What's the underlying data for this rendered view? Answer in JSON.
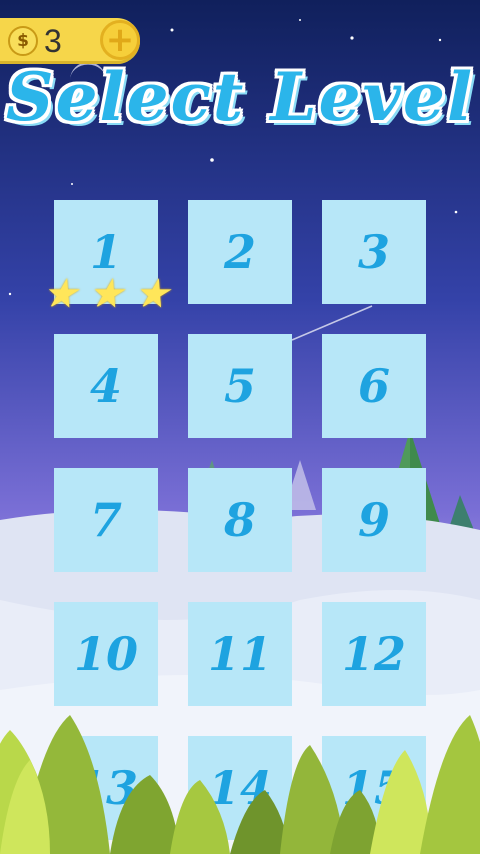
{
  "coins": {
    "currency_symbol": "$",
    "count": "3",
    "add_label": "+"
  },
  "title": "Select Level",
  "levels": [
    {
      "label": "1",
      "stars": 3
    },
    {
      "label": "2",
      "stars": 0
    },
    {
      "label": "3",
      "stars": 0
    },
    {
      "label": "4",
      "stars": 0
    },
    {
      "label": "5",
      "stars": 0
    },
    {
      "label": "6",
      "stars": 0
    },
    {
      "label": "7",
      "stars": 0
    },
    {
      "label": "8",
      "stars": 0
    },
    {
      "label": "9",
      "stars": 0
    },
    {
      "label": "10",
      "stars": 0
    },
    {
      "label": "11",
      "stars": 0
    },
    {
      "label": "12",
      "stars": 0
    },
    {
      "label": "13",
      "stars": 0
    },
    {
      "label": "14",
      "stars": 0
    },
    {
      "label": "15",
      "stars": 0
    }
  ],
  "colors": {
    "sky_top": "#12205e",
    "sky_bottom": "#9a8fe0",
    "snow": "#dfe6f4",
    "tile": "#b7e7f8",
    "tile_text": "#1ea3e0",
    "title": "#2bb5ea",
    "coin_bar": "#f6d64a"
  }
}
